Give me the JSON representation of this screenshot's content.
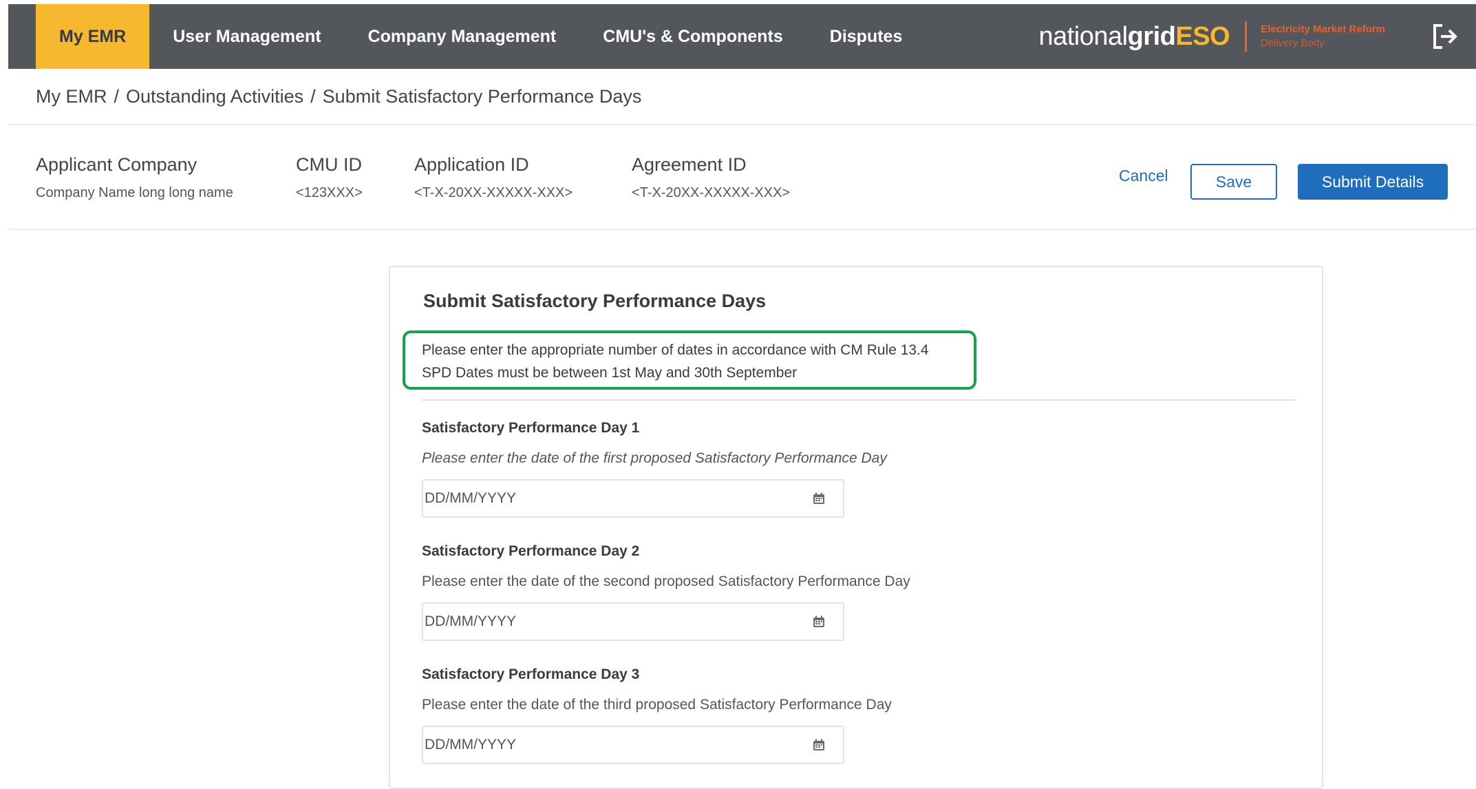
{
  "nav": {
    "items": [
      {
        "label": "My EMR",
        "active": true
      },
      {
        "label": "User Management",
        "active": false
      },
      {
        "label": "Company Management",
        "active": false
      },
      {
        "label": "CMU's & Components",
        "active": false
      },
      {
        "label": "Disputes",
        "active": false
      }
    ],
    "brand": {
      "national": "national",
      "grid": "grid",
      "eso": "ESO",
      "sub_line1": "Electricity Market Reform",
      "sub_line2": "Delivery Body"
    },
    "logout_icon": "logout-icon"
  },
  "breadcrumb": [
    "My EMR",
    "Outstanding Activities",
    "Submit Satisfactory Performance Days"
  ],
  "breadcrumb_separator": "/",
  "summary": {
    "applicant_company": {
      "label": "Applicant Company",
      "value": "Company Name long long name"
    },
    "cmu_id": {
      "label": "CMU ID",
      "value": "<123XXX>"
    },
    "application_id": {
      "label": "Application ID",
      "value": "<T-X-20XX-XXXXX-XXX>"
    },
    "agreement_id": {
      "label": "Agreement ID",
      "value": "<T-X-20XX-XXXXX-XXX>"
    }
  },
  "actions": {
    "cancel": "Cancel",
    "save": "Save",
    "submit": "Submit Details"
  },
  "form": {
    "title": "Submit Satisfactory Performance Days",
    "notice_line1": "Please enter the appropriate number of dates in accordance with CM Rule 13.4",
    "notice_line2": "SPD Dates must be between 1st May and 30th September",
    "days": [
      {
        "label": "Satisfactory Performance Day 1",
        "help": "Please enter the date of the first proposed Satisfactory Performance Day",
        "placeholder": "DD/MM/YYYY"
      },
      {
        "label": "Satisfactory Performance Day 2",
        "help": "Please enter the date of the second proposed Satisfactory Performance Day",
        "placeholder": "DD/MM/YYYY"
      },
      {
        "label": "Satisfactory Performance Day 3",
        "help": "Please enter the date of the third proposed Satisfactory Performance Day",
        "placeholder": "DD/MM/YYYY"
      }
    ]
  },
  "colors": {
    "nav_bg": "#53575c",
    "nav_active": "#f6b82e",
    "primary": "#1f6dbd",
    "notice_border": "#17a34a",
    "brand_orange": "#e8622a"
  }
}
